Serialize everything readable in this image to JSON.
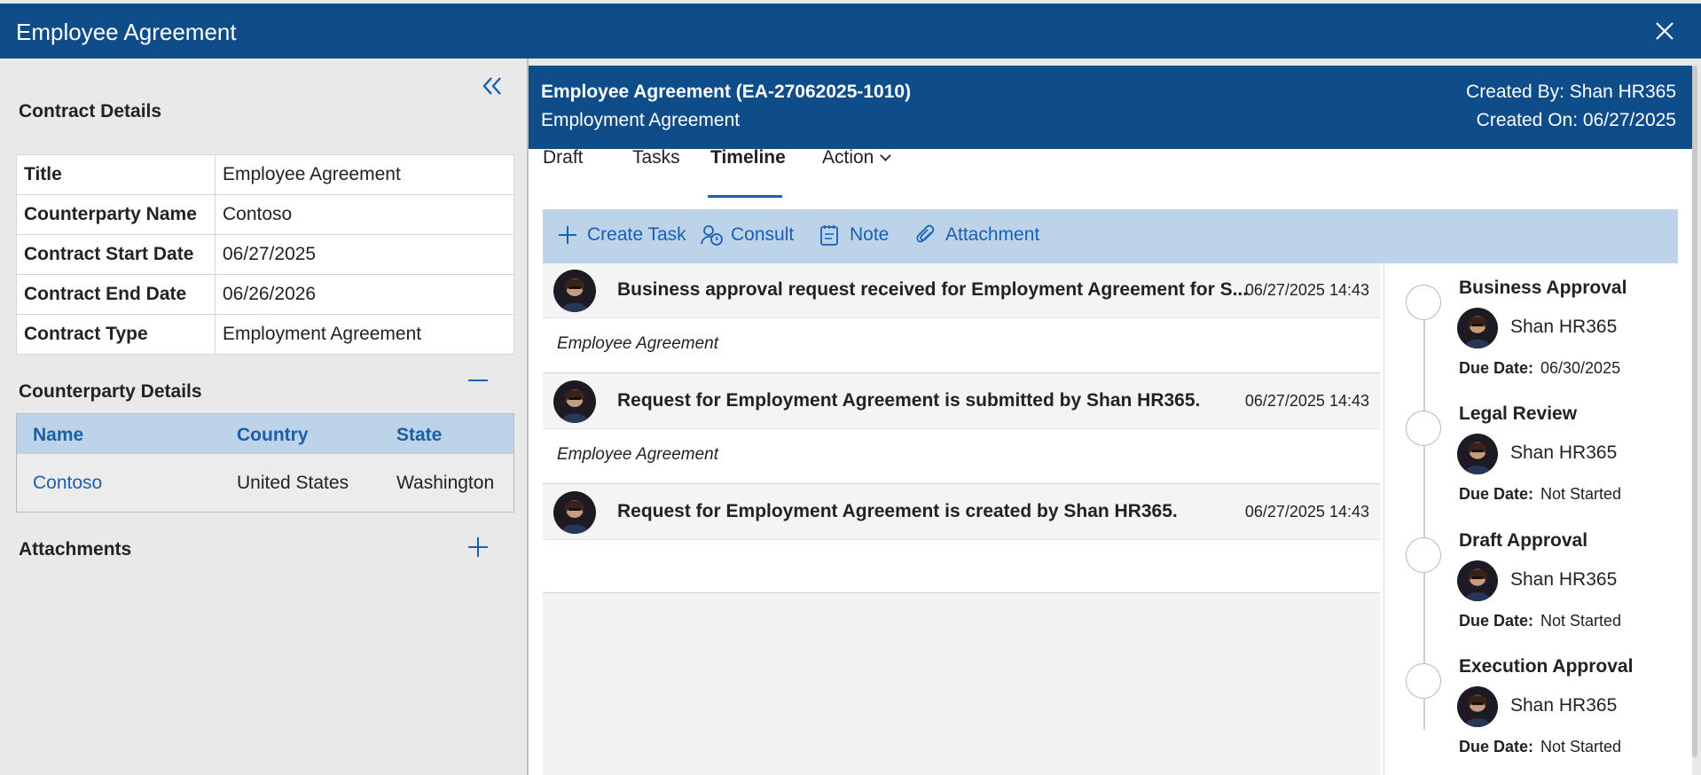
{
  "window": {
    "title": "Employee Agreement"
  },
  "left_panel": {
    "contract_details_heading": "Contract Details",
    "contract_rows": [
      {
        "label": "Title",
        "value": "Employee Agreement"
      },
      {
        "label": "Counterparty Name",
        "value": "Contoso"
      },
      {
        "label": "Contract Start Date",
        "value": "06/27/2025"
      },
      {
        "label": "Contract End Date",
        "value": "06/26/2026"
      },
      {
        "label": "Contract Type",
        "value": "Employment Agreement"
      }
    ],
    "counterparty_heading": "Counterparty Details",
    "counterparty_columns": [
      "Name",
      "Country",
      "State"
    ],
    "counterparty_row": {
      "name": "Contoso",
      "country": "United States",
      "state": "Washington"
    },
    "attachments_heading": "Attachments"
  },
  "record": {
    "title": "Employee Agreement (EA-27062025-1010)",
    "subtitle": "Employment Agreement",
    "created_by": "Created By: Shan HR365",
    "created_on": "Created On: 06/27/2025"
  },
  "tabs": [
    {
      "label": "Draft",
      "active": false
    },
    {
      "label": "Tasks",
      "active": false
    },
    {
      "label": "Timeline",
      "active": true
    },
    {
      "label": "Action",
      "active": false
    }
  ],
  "toolbar": {
    "create_task": "Create Task",
    "consult": "Consult",
    "note": "Note",
    "attachment": "Attachment"
  },
  "timeline": [
    {
      "message": "Business approval request received for Employment Agreement for S...",
      "date": "06/27/2025 14:43",
      "sub": "Employee Agreement"
    },
    {
      "message": "Request for Employment Agreement is submitted by Shan HR365.",
      "date": "06/27/2025 14:43",
      "sub": "Employee Agreement"
    },
    {
      "message": "Request for Employment Agreement is created by Shan HR365.",
      "date": "06/27/2025 14:43",
      "sub": ""
    }
  ],
  "approvals": {
    "due_label": "Due Date:",
    "steps": [
      {
        "title": "Business Approval",
        "person": "Shan HR365",
        "due": "06/30/2025"
      },
      {
        "title": "Legal Review",
        "person": "Shan HR365",
        "due": "Not Started"
      },
      {
        "title": "Draft Approval",
        "person": "Shan HR365",
        "due": "Not Started"
      },
      {
        "title": "Execution Approval",
        "person": "Shan HR365",
        "due": "Not Started"
      }
    ]
  },
  "colors": {
    "header_blue": "#0f4c8a",
    "accent_blue": "#1a5fb4",
    "toolbar_bg": "#bcd3ea"
  }
}
